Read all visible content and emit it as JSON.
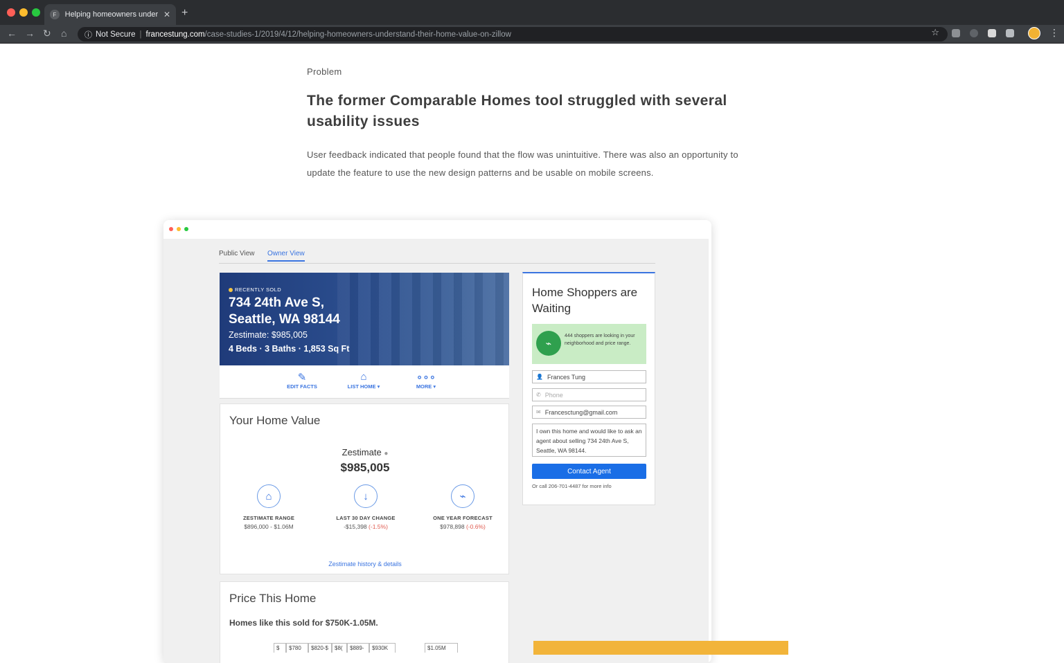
{
  "browser": {
    "tab_title": "Helping homeowners understand",
    "favicon_letter": "F",
    "not_secure": "Not Secure",
    "url_host": "francestung.com",
    "url_path": "/case-studies-1/2019/4/12/helping-homeowners-understand-their-home-value-on-zillow",
    "icons": {
      "back": "back-arrow-icon",
      "forward": "forward-arrow-icon",
      "reload": "reload-icon",
      "home": "home-icon",
      "star": "star-icon",
      "menu": "kebab-menu-icon"
    }
  },
  "article": {
    "eyebrow": "Problem",
    "headline": "The former Comparable Homes tool struggled with several usability issues",
    "body": "User feedback indicated that people found that the flow was unintuitive. There was also an opportunity to update the feature to use the new design patterns and be usable on mobile screens."
  },
  "mockup": {
    "tabs": {
      "public": "Public View",
      "owner": "Owner View"
    },
    "hero": {
      "badge": "RECENTLY SOLD",
      "address_line1": "734 24th Ave S,",
      "address_line2": "Seattle, WA 98144",
      "zestimate": "Zestimate: $985,005",
      "facts": "4 Beds · 3 Baths · 1,853 Sq Ft"
    },
    "actions": {
      "edit": "EDIT FACTS",
      "list": "LIST HOME ▾",
      "more": "MORE ▾"
    },
    "home_value": {
      "title": "Your Home Value",
      "zestimate_label": "Zestimate",
      "zestimate_value": "$985,005",
      "range_label": "ZESTIMATE RANGE",
      "range_value": "$896,000 - $1.06M",
      "change_label": "LAST 30 DAY CHANGE",
      "change_value": "-$15,398",
      "change_pct": "(-1.5%)",
      "forecast_label": "ONE YEAR FORECAST",
      "forecast_value": "$978,898",
      "forecast_pct": "(-0.6%)",
      "link": "Zestimate history & details"
    },
    "price_home": {
      "title": "Price This Home",
      "subtitle": "Homes like this sold for $750K-1.05M.",
      "bins": [
        "$",
        "$780",
        "$820-$",
        "$8(",
        "$889-",
        "$930K"
      ],
      "max_bin": "$1.05M"
    },
    "side": {
      "title": "Home Shoppers are Waiting",
      "alert": "444 shoppers are looking in your neighborhood and price range.",
      "name_value": "Frances Tung",
      "phone_placeholder": "Phone",
      "email_value": "Francesctung@gmail.com",
      "message": "I own this home and would like to ask an agent about selling 734 24th Ave S, Seattle, WA 98144.",
      "button": "Contact Agent",
      "call_text": "Or call 206-701-4487 for more info"
    }
  },
  "colors": {
    "accent": "#3a74e0",
    "green": "#2fa04e",
    "alert_bg": "#c9ecc5",
    "negative": "#e05a4f",
    "yellow": "#f2b43a"
  }
}
